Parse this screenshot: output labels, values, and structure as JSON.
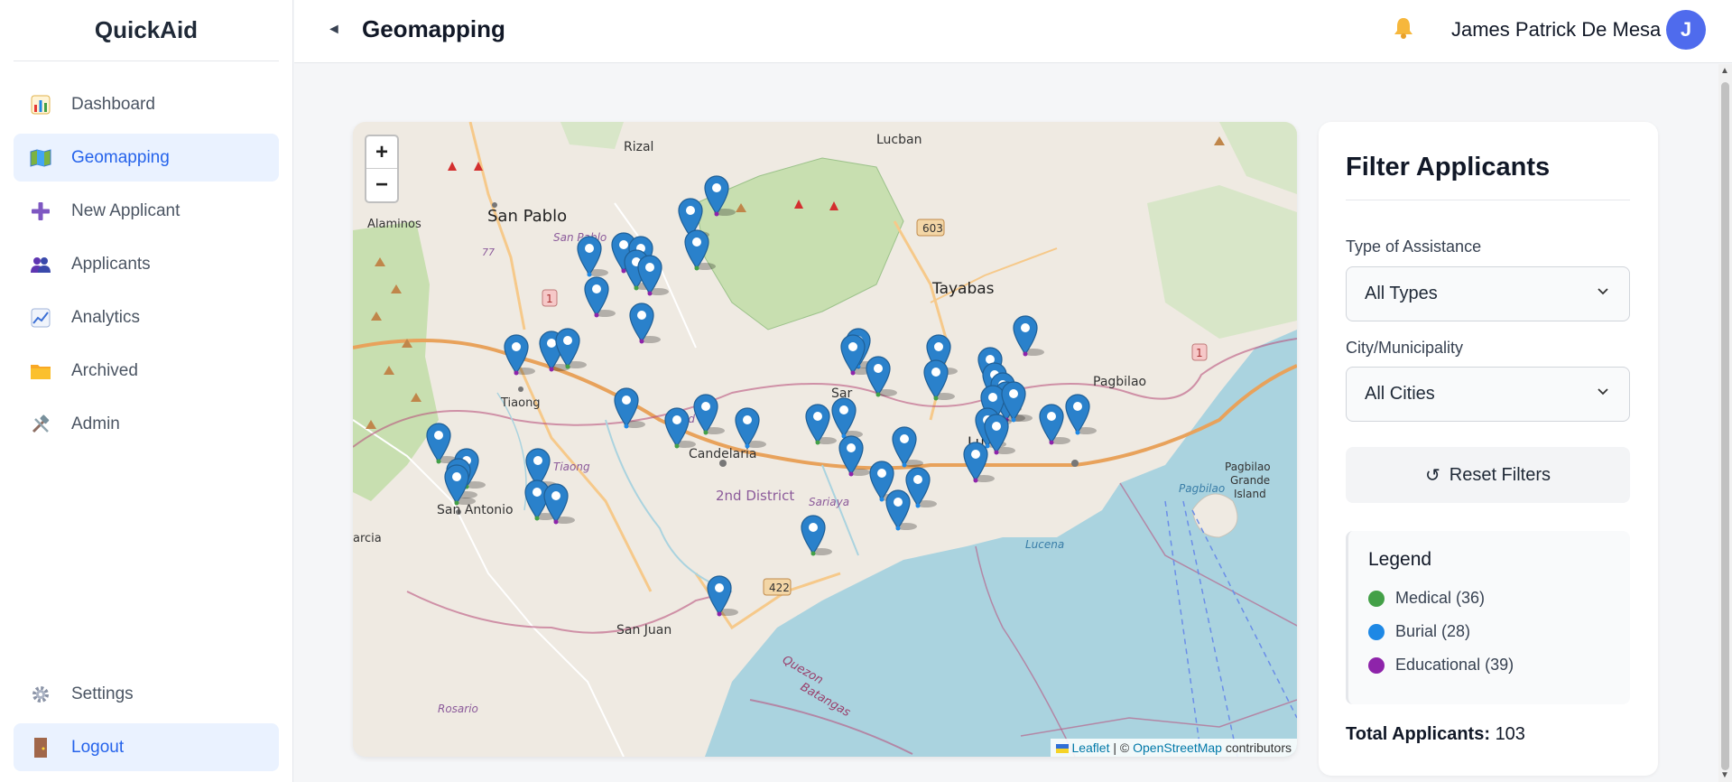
{
  "app": {
    "title": "QuickAid"
  },
  "sidebar": {
    "items": [
      {
        "label": "Dashboard",
        "icon": "chart-icon"
      },
      {
        "label": "Geomapping",
        "icon": "map-icon",
        "active": true
      },
      {
        "label": "New Applicant",
        "icon": "plus-icon"
      },
      {
        "label": "Applicants",
        "icon": "users-icon"
      },
      {
        "label": "Analytics",
        "icon": "trend-icon"
      },
      {
        "label": "Archived",
        "icon": "folder-icon"
      },
      {
        "label": "Admin",
        "icon": "tools-icon"
      }
    ],
    "bottom": [
      {
        "label": "Settings",
        "icon": "gear-icon"
      },
      {
        "label": "Logout",
        "icon": "door-icon"
      }
    ]
  },
  "header": {
    "collapse_icon": "◄",
    "title": "Geomapping",
    "user_name": "James Patrick De Mesa",
    "avatar_initial": "J"
  },
  "map": {
    "zoom_in": "+",
    "zoom_out": "−",
    "labels": {
      "rizal": "Rizal",
      "lucban": "Lucban",
      "san_pablo": "San Pablo",
      "san_pablo_it": "San Pablo",
      "alaminos": "Alaminos",
      "tayabas": "Tayabas",
      "tiaong": "Tiaong",
      "tiaong_it": "Tiaong",
      "candelaria": "Candelaria",
      "candelaria_it": "Cand",
      "second_district": "2nd District",
      "sariaya": "Sariaya",
      "sariaya_short": "Sar",
      "lucena": "Lu",
      "lucena_it": "Lucena",
      "pagbilao": "Pagbilao",
      "pagbilao_grande": "Pagbilao",
      "pagbilao_grande2": "Grande",
      "pagbilao_grande3": "Island",
      "pagbilao_it": "Pagbilao",
      "san_antonio": "San Antonio",
      "garcia": "arcia",
      "san_juan": "San Juan",
      "rosario": "Rosario",
      "quezon": "Quezon",
      "batangas": "Batangas",
      "road_603": "603",
      "road_1a": "1",
      "road_1b": "1",
      "road_422": "422",
      "road_77": "77"
    },
    "attribution": {
      "leaflet": "Leaflet",
      "sep": " | © ",
      "osm": "OpenStreetMap",
      "suffix": " contributors"
    },
    "markers": [
      {
        "lng": 0.385,
        "lat": 0.145,
        "type": "educational"
      },
      {
        "lng": 0.358,
        "lat": 0.18,
        "type": "educational"
      },
      {
        "lng": 0.364,
        "lat": 0.23,
        "type": "medical"
      },
      {
        "lng": 0.25,
        "lat": 0.24,
        "type": "burial"
      },
      {
        "lng": 0.287,
        "lat": 0.235,
        "type": "educational"
      },
      {
        "lng": 0.305,
        "lat": 0.24,
        "type": "burial"
      },
      {
        "lng": 0.3,
        "lat": 0.262,
        "type": "medical"
      },
      {
        "lng": 0.315,
        "lat": 0.27,
        "type": "educational"
      },
      {
        "lng": 0.258,
        "lat": 0.305,
        "type": "educational"
      },
      {
        "lng": 0.306,
        "lat": 0.345,
        "type": "educational"
      },
      {
        "lng": 0.173,
        "lat": 0.395,
        "type": "educational"
      },
      {
        "lng": 0.21,
        "lat": 0.39,
        "type": "educational"
      },
      {
        "lng": 0.228,
        "lat": 0.385,
        "type": "medical"
      },
      {
        "lng": 0.29,
        "lat": 0.48,
        "type": "burial"
      },
      {
        "lng": 0.374,
        "lat": 0.49,
        "type": "medical"
      },
      {
        "lng": 0.343,
        "lat": 0.51,
        "type": "medical"
      },
      {
        "lng": 0.418,
        "lat": 0.51,
        "type": "burial"
      },
      {
        "lng": 0.091,
        "lat": 0.535,
        "type": "medical"
      },
      {
        "lng": 0.12,
        "lat": 0.575,
        "type": "medical"
      },
      {
        "lng": 0.112,
        "lat": 0.59,
        "type": "burial"
      },
      {
        "lng": 0.11,
        "lat": 0.6,
        "type": "medical"
      },
      {
        "lng": 0.196,
        "lat": 0.575,
        "type": "burial"
      },
      {
        "lng": 0.195,
        "lat": 0.625,
        "type": "medical"
      },
      {
        "lng": 0.215,
        "lat": 0.63,
        "type": "educational"
      },
      {
        "lng": 0.535,
        "lat": 0.385,
        "type": "burial"
      },
      {
        "lng": 0.53,
        "lat": 0.395,
        "type": "educational"
      },
      {
        "lng": 0.556,
        "lat": 0.43,
        "type": "medical"
      },
      {
        "lng": 0.62,
        "lat": 0.395,
        "type": "burial"
      },
      {
        "lng": 0.618,
        "lat": 0.435,
        "type": "medical"
      },
      {
        "lng": 0.712,
        "lat": 0.365,
        "type": "educational"
      },
      {
        "lng": 0.675,
        "lat": 0.415,
        "type": "burial"
      },
      {
        "lng": 0.68,
        "lat": 0.44,
        "type": "medical"
      },
      {
        "lng": 0.688,
        "lat": 0.455,
        "type": "burial"
      },
      {
        "lng": 0.692,
        "lat": 0.47,
        "type": "educational"
      },
      {
        "lng": 0.678,
        "lat": 0.475,
        "type": "medical"
      },
      {
        "lng": 0.7,
        "lat": 0.47,
        "type": "burial"
      },
      {
        "lng": 0.672,
        "lat": 0.51,
        "type": "burial"
      },
      {
        "lng": 0.682,
        "lat": 0.52,
        "type": "educational"
      },
      {
        "lng": 0.66,
        "lat": 0.565,
        "type": "educational"
      },
      {
        "lng": 0.74,
        "lat": 0.505,
        "type": "educational"
      },
      {
        "lng": 0.768,
        "lat": 0.49,
        "type": "burial"
      },
      {
        "lng": 0.492,
        "lat": 0.505,
        "type": "medical"
      },
      {
        "lng": 0.52,
        "lat": 0.495,
        "type": "burial"
      },
      {
        "lng": 0.528,
        "lat": 0.555,
        "type": "educational"
      },
      {
        "lng": 0.584,
        "lat": 0.54,
        "type": "burial"
      },
      {
        "lng": 0.56,
        "lat": 0.595,
        "type": "burial"
      },
      {
        "lng": 0.598,
        "lat": 0.605,
        "type": "burial"
      },
      {
        "lng": 0.577,
        "lat": 0.64,
        "type": "burial"
      },
      {
        "lng": 0.488,
        "lat": 0.68,
        "type": "medical"
      },
      {
        "lng": 0.388,
        "lat": 0.775,
        "type": "educational"
      }
    ]
  },
  "filter": {
    "title": "Filter Applicants",
    "type_label": "Type of Assistance",
    "type_value": "All Types",
    "city_label": "City/Municipality",
    "city_value": "All Cities",
    "reset_label": "Reset Filters",
    "reset_icon": "↺",
    "legend_title": "Legend",
    "legend": [
      {
        "label": "Medical (36)",
        "color": "#43a047"
      },
      {
        "label": "Burial (28)",
        "color": "#1e88e5"
      },
      {
        "label": "Educational (39)",
        "color": "#8e24aa"
      }
    ],
    "total_label": "Total Applicants:",
    "total_value": "103"
  },
  "colors": {
    "accent": "#2563eb",
    "active_bg": "#eaf2ff",
    "marker": "#2a81cb",
    "water": "#aad3df",
    "park": "#c8dfb0"
  }
}
